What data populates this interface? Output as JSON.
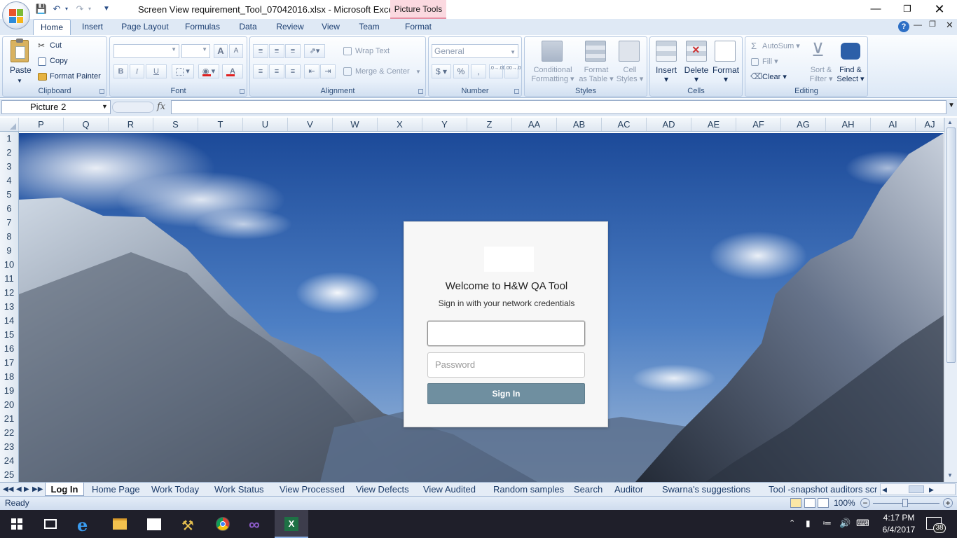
{
  "window": {
    "doc_title": "Screen View requirement_Tool_07042016.xlsx - Microsoft Excel",
    "context_tab": "Picture Tools"
  },
  "tabs": [
    "Home",
    "Insert",
    "Page Layout",
    "Formulas",
    "Data",
    "Review",
    "View",
    "Team",
    "Format"
  ],
  "ribbon": {
    "clipboard": {
      "paste": "Paste",
      "cut": "Cut",
      "copy": "Copy",
      "format_painter": "Format Painter",
      "label": "Clipboard"
    },
    "font": {
      "label": "Font",
      "bold": "B",
      "italic": "I",
      "underline": "U",
      "grow": "A",
      "shrink": "A",
      "color_a": "A"
    },
    "alignment": {
      "wrap": "Wrap Text",
      "merge": "Merge & Center",
      "label": "Alignment"
    },
    "number": {
      "format": "General",
      "currency": "$",
      "percent": "%",
      "comma": ",",
      "inc": ".0→.00",
      "dec": ".00→.0",
      "label": "Number"
    },
    "styles": {
      "conditional_1": "Conditional",
      "conditional_2": "Formatting",
      "format_table_1": "Format",
      "format_table_2": "as Table",
      "cell_styles_1": "Cell",
      "cell_styles_2": "Styles",
      "label": "Styles"
    },
    "cells": {
      "insert": "Insert",
      "delete": "Delete",
      "format": "Format",
      "label": "Cells"
    },
    "editing": {
      "autosum": "AutoSum",
      "fill": "Fill",
      "clear": "Clear",
      "sort_1": "Sort &",
      "sort_2": "Filter",
      "find_1": "Find &",
      "find_2": "Select",
      "label": "Editing"
    }
  },
  "formula_bar": {
    "name_box": "Picture 2",
    "fx": "fx",
    "formula": ""
  },
  "columns": [
    "P",
    "Q",
    "R",
    "S",
    "T",
    "U",
    "V",
    "W",
    "X",
    "Y",
    "Z",
    "AA",
    "AB",
    "AC",
    "AD",
    "AE",
    "AF",
    "AG",
    "AH",
    "AI",
    "AJ"
  ],
  "rows": [
    "1",
    "2",
    "3",
    "4",
    "5",
    "6",
    "7",
    "8",
    "9",
    "10",
    "11",
    "12",
    "13",
    "14",
    "15",
    "16",
    "17",
    "18",
    "19",
    "20",
    "21",
    "22",
    "23",
    "24",
    "25"
  ],
  "login": {
    "title": "Welcome to H&W QA Tool",
    "subtitle": "Sign in with your network credentials",
    "username_value": "",
    "password_placeholder": "Password",
    "sign_in": "Sign In"
  },
  "sheet_tabs": [
    "Log In",
    "Home Page",
    "Work Today",
    "Work Status",
    "View Processed",
    "View Defects",
    "View Audited",
    "Random samples",
    "Search",
    "Auditor",
    "Swarna's suggestions",
    "Tool -snapshot auditors scre"
  ],
  "active_sheet": "Log In",
  "status": {
    "text": "Ready",
    "zoom": "100%"
  },
  "taskbar": {
    "time": "4:17 PM",
    "date": "6/4/2017",
    "notifications": "38"
  },
  "colors": {
    "accent": "#15305a",
    "ribbon_bg": "#dce8f6",
    "sign_in_button": "#6f8fa0",
    "taskbar": "#1f1f2a",
    "context_tab": "#fbd9e0"
  }
}
